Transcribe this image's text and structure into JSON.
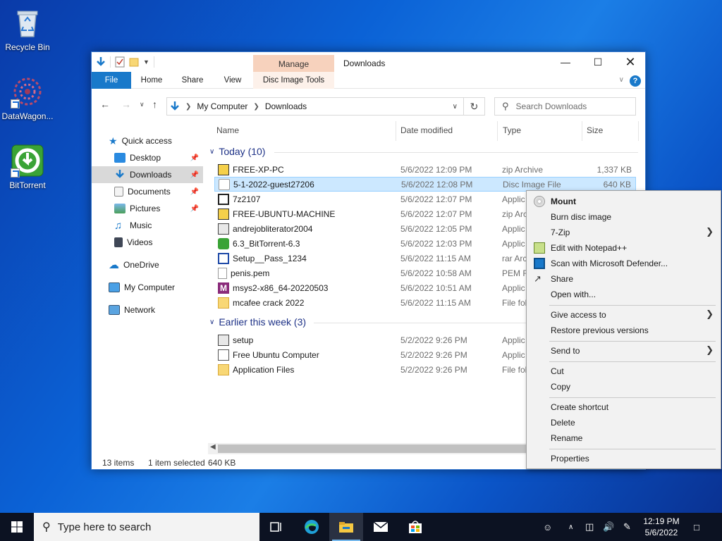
{
  "desktop": {
    "icons": [
      {
        "label": "Recycle Bin"
      },
      {
        "label": "DataWagon..."
      },
      {
        "label": "BitTorrent"
      }
    ]
  },
  "window": {
    "title": "Downloads",
    "contextual_tab_group": "Manage",
    "ribbon_tabs": [
      "File",
      "Home",
      "Share",
      "View",
      "Disc Image Tools"
    ],
    "address": {
      "breadcrumb": [
        "My Computer",
        "Downloads"
      ]
    },
    "search": {
      "placeholder": "Search Downloads"
    },
    "columns": {
      "name": "Name",
      "date": "Date modified",
      "type": "Type",
      "size": "Size"
    },
    "nav": {
      "items": [
        {
          "label": "Quick access"
        },
        {
          "label": "Desktop"
        },
        {
          "label": "Downloads"
        },
        {
          "label": "Documents"
        },
        {
          "label": "Pictures"
        },
        {
          "label": "Music"
        },
        {
          "label": "Videos"
        },
        {
          "label": "OneDrive"
        },
        {
          "label": "My Computer"
        },
        {
          "label": "Network"
        }
      ]
    },
    "groups": [
      {
        "label": "Today (10)"
      },
      {
        "label": "Earlier this week (3)"
      }
    ],
    "files": [
      {
        "name": "FREE-XP-PC",
        "date": "5/6/2022 12:09 PM",
        "type": "zip Archive",
        "size": "1,337 KB"
      },
      {
        "name": "5-1-2022-guest27206",
        "date": "5/6/2022 12:08 PM",
        "type": "Disc Image File",
        "size": "640 KB"
      },
      {
        "name": "7z2107",
        "date": "5/6/2022 12:07 PM",
        "type": "Applic",
        "size": ""
      },
      {
        "name": "FREE-UBUNTU-MACHINE",
        "date": "5/6/2022 12:07 PM",
        "type": "zip Arc",
        "size": ""
      },
      {
        "name": "andrejobliterator2004",
        "date": "5/6/2022 12:05 PM",
        "type": "Applic",
        "size": ""
      },
      {
        "name": "6.3_BitTorrent-6.3",
        "date": "5/6/2022 12:03 PM",
        "type": "Applic",
        "size": ""
      },
      {
        "name": "Setup__Pass_1234",
        "date": "5/6/2022 11:15 AM",
        "type": "rar Arc",
        "size": ""
      },
      {
        "name": "penis.pem",
        "date": "5/6/2022 10:58 AM",
        "type": "PEM F",
        "size": ""
      },
      {
        "name": "msys2-x86_64-20220503",
        "date": "5/6/2022 10:51 AM",
        "type": "Applic",
        "size": ""
      },
      {
        "name": "mcafee crack 2022",
        "date": "5/6/2022 11:15 AM",
        "type": "File fol",
        "size": ""
      },
      {
        "name": "setup",
        "date": "5/2/2022 9:26 PM",
        "type": "Applic",
        "size": ""
      },
      {
        "name": "Free Ubuntu Computer",
        "date": "5/2/2022 9:26 PM",
        "type": "Applic",
        "size": ""
      },
      {
        "name": "Application Files",
        "date": "5/2/2022 9:26 PM",
        "type": "File fol",
        "size": ""
      }
    ],
    "status": {
      "count": "13 items",
      "selected": "1 item selected",
      "size": "640 KB"
    }
  },
  "context_menu": {
    "items": [
      {
        "label": "Mount"
      },
      {
        "label": "Burn disc image"
      },
      {
        "label": "7-Zip"
      },
      {
        "label": "Edit with Notepad++"
      },
      {
        "label": "Scan with Microsoft Defender..."
      },
      {
        "label": "Share"
      },
      {
        "label": "Open with..."
      },
      {
        "label": "Give access to"
      },
      {
        "label": "Restore previous versions"
      },
      {
        "label": "Send to"
      },
      {
        "label": "Cut"
      },
      {
        "label": "Copy"
      },
      {
        "label": "Create shortcut"
      },
      {
        "label": "Delete"
      },
      {
        "label": "Rename"
      },
      {
        "label": "Properties"
      }
    ]
  },
  "taskbar": {
    "search_placeholder": "Type here to search",
    "time": "12:19 PM",
    "date": "5/6/2022"
  },
  "colors": {
    "accent": "#1979ca",
    "selection": "#cce8ff",
    "manage_tab": "#f7d2bd",
    "taskbar": "#0c1222"
  }
}
